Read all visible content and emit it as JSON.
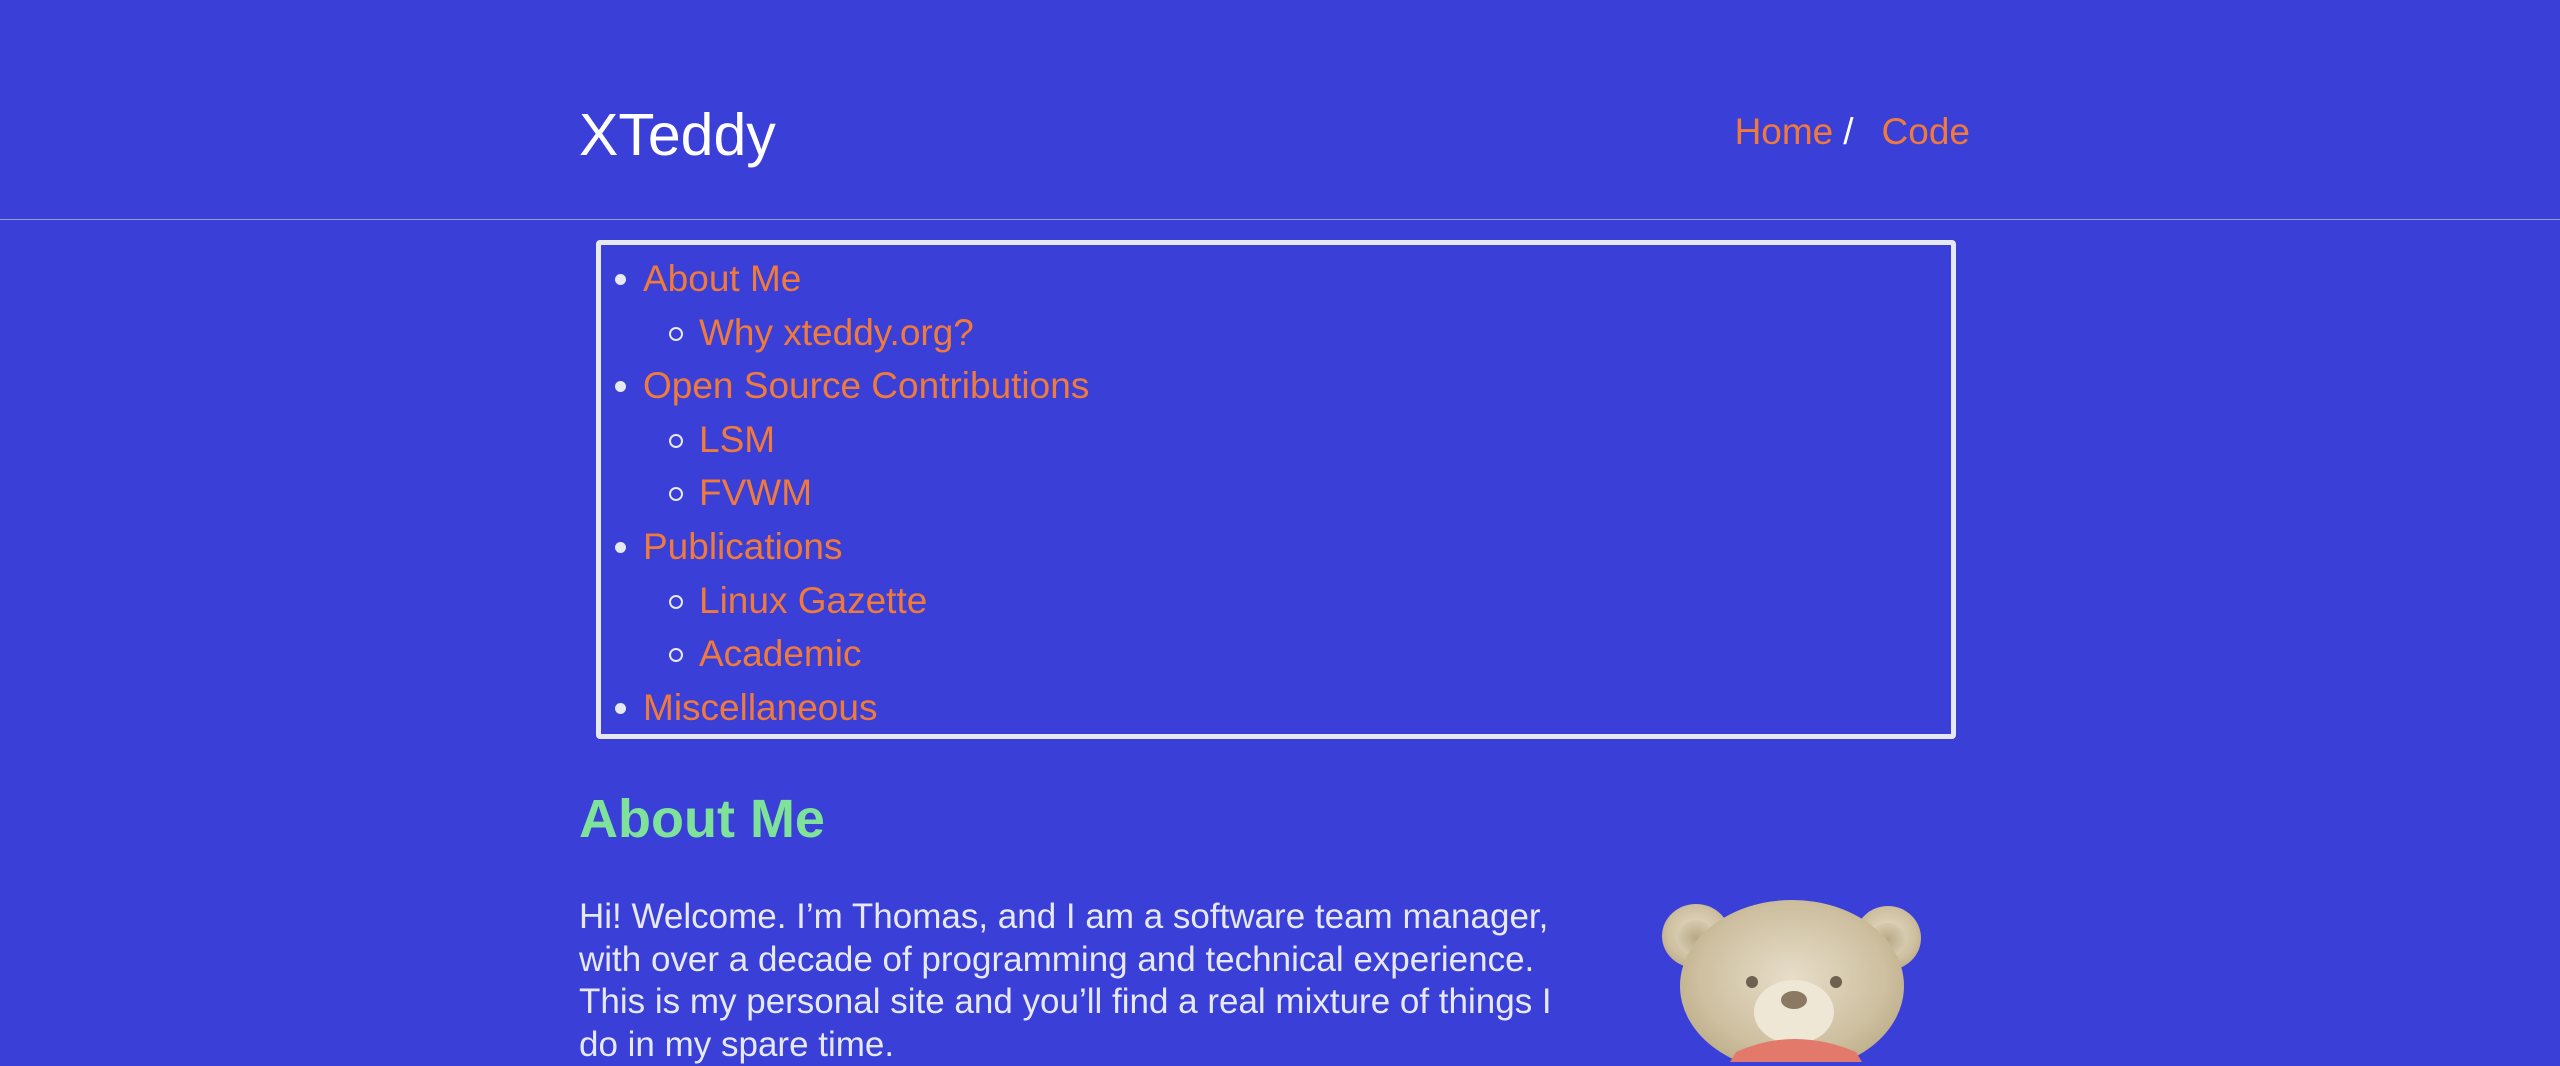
{
  "header": {
    "site_title": "XTeddy",
    "nav": {
      "home": "Home",
      "separator": "/",
      "code": "Code"
    }
  },
  "toc": {
    "items": [
      {
        "label": "About Me",
        "level": 1
      },
      {
        "label": "Why xteddy.org?",
        "level": 2
      },
      {
        "label": "Open Source Contributions",
        "level": 1
      },
      {
        "label": "LSM",
        "level": 2
      },
      {
        "label": "FVWM",
        "level": 2
      },
      {
        "label": "Publications",
        "level": 1
      },
      {
        "label": "Linux Gazette",
        "level": 2
      },
      {
        "label": "Academic",
        "level": 2
      },
      {
        "label": "Miscellaneous",
        "level": 1
      }
    ]
  },
  "main": {
    "heading": "About Me",
    "intro": "Hi! Welcome. I’m Thomas, and I am a software team manager, with over a decade of programming and technical experience. This is my personal site and you’ll find a real mixture of things I do in my spare time."
  },
  "image": {
    "name": "teddy-bear"
  },
  "colors": {
    "background": "#3a3fd8",
    "link": "#f07a3c",
    "heading": "#7ee29a",
    "text": "#e6e8f2",
    "title": "#ffffff"
  }
}
